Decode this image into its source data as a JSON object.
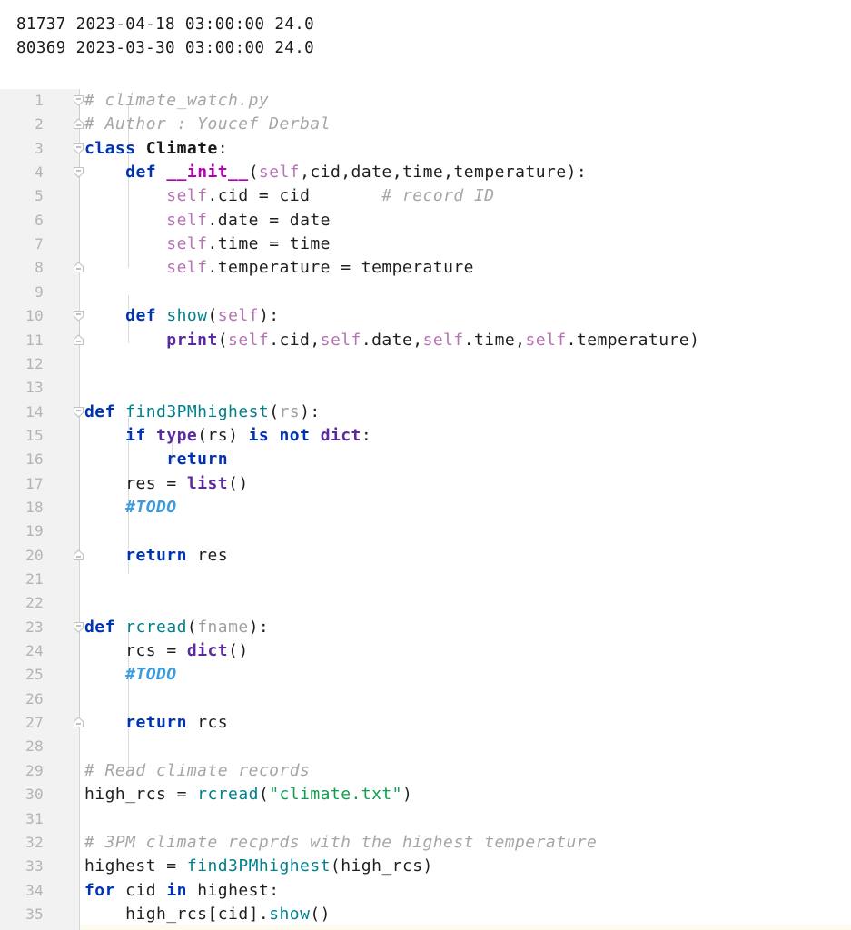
{
  "console": {
    "name": "program-output",
    "lines": [
      "81737 2023-04-18 03:00:00 24.0",
      "80369 2023-03-30 03:00:00 24.0"
    ]
  },
  "editor": {
    "filename": "climate_watch.py",
    "language": "Python",
    "first_line_number": 1,
    "last_line_number": 35,
    "colors": {
      "background": "#ffffff",
      "gutter_background": "#f2f2f2",
      "line_number": "#b4b4b4",
      "keyword": "#0033b3",
      "function": "#00808b",
      "self_param": "#b772b4",
      "builtin": "#5a2a9e",
      "string": "#0f9d4f",
      "comment": "#a6a6a6",
      "todo": "#3b9bdd",
      "text": "#1f1f1f",
      "indent_guide": "#dcdcdc"
    },
    "lines": [
      {
        "n": "1",
        "text": "# climate_watch.py"
      },
      {
        "n": "2",
        "text": "# Author : Youcef Derbal"
      },
      {
        "n": "3",
        "text": "class Climate:"
      },
      {
        "n": "4",
        "text": "    def __init__(self,cid,date,time,temperature):"
      },
      {
        "n": "5",
        "text": "        self.cid = cid       # record ID"
      },
      {
        "n": "6",
        "text": "        self.date = date"
      },
      {
        "n": "7",
        "text": "        self.time = time"
      },
      {
        "n": "8",
        "text": "        self.temperature = temperature"
      },
      {
        "n": "9",
        "text": ""
      },
      {
        "n": "10",
        "text": "    def show(self):"
      },
      {
        "n": "11",
        "text": "        print(self.cid,self.date,self.time,self.temperature)"
      },
      {
        "n": "12",
        "text": ""
      },
      {
        "n": "13",
        "text": ""
      },
      {
        "n": "14",
        "text": "def find3PMhighest(rs):"
      },
      {
        "n": "15",
        "text": "    if type(rs) is not dict:"
      },
      {
        "n": "16",
        "text": "        return"
      },
      {
        "n": "17",
        "text": "    res = list()"
      },
      {
        "n": "18",
        "text": "    #TODO"
      },
      {
        "n": "19",
        "text": ""
      },
      {
        "n": "20",
        "text": "    return res"
      },
      {
        "n": "21",
        "text": ""
      },
      {
        "n": "22",
        "text": ""
      },
      {
        "n": "23",
        "text": "def rcread(fname):"
      },
      {
        "n": "24",
        "text": "    rcs = dict()"
      },
      {
        "n": "25",
        "text": "    #TODO"
      },
      {
        "n": "26",
        "text": ""
      },
      {
        "n": "27",
        "text": "    return rcs"
      },
      {
        "n": "28",
        "text": ""
      },
      {
        "n": "29",
        "text": "# Read climate records"
      },
      {
        "n": "30",
        "text": "high_rcs = rcread(\"climate.txt\")"
      },
      {
        "n": "31",
        "text": ""
      },
      {
        "n": "32",
        "text": "# 3PM climate recprds with the highest temperature"
      },
      {
        "n": "33",
        "text": "highest = find3PMhighest(high_rcs)"
      },
      {
        "n": "34",
        "text": "for cid in highest:"
      },
      {
        "n": "35",
        "text": "    high_rcs[cid].show()"
      }
    ],
    "fold_markers": [
      {
        "line": 1,
        "type": "fold-start"
      },
      {
        "line": 2,
        "type": "fold-end"
      },
      {
        "line": 3,
        "type": "fold-start"
      },
      {
        "line": 4,
        "type": "fold-start"
      },
      {
        "line": 8,
        "type": "fold-end"
      },
      {
        "line": 10,
        "type": "fold-start"
      },
      {
        "line": 11,
        "type": "fold-end"
      },
      {
        "line": 14,
        "type": "fold-start"
      },
      {
        "line": 20,
        "type": "fold-end"
      },
      {
        "line": 23,
        "type": "fold-start"
      },
      {
        "line": 27,
        "type": "fold-end"
      }
    ]
  }
}
